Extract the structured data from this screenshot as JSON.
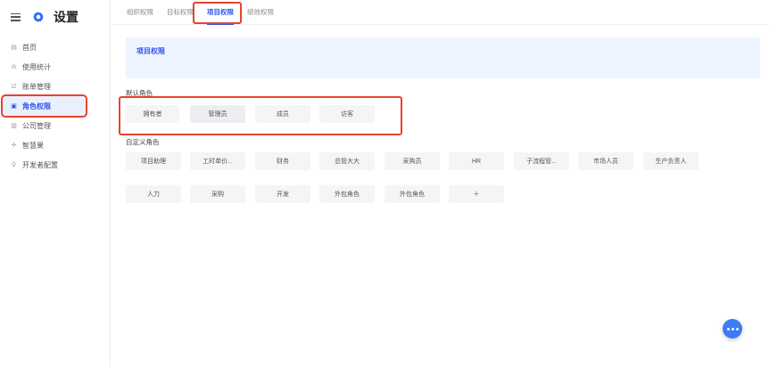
{
  "app": {
    "title": "设置"
  },
  "sidebar": {
    "items": [
      {
        "label": "首页",
        "icon": "home-icon"
      },
      {
        "label": "使用统计",
        "icon": "chart-icon"
      },
      {
        "label": "账单管理",
        "icon": "bill-icon"
      },
      {
        "label": "角色权限",
        "icon": "lock-icon",
        "active": true
      },
      {
        "label": "公司管理",
        "icon": "building-icon"
      },
      {
        "label": "智慧果",
        "icon": "fruit-icon"
      },
      {
        "label": "开发者配置",
        "icon": "key-icon"
      }
    ]
  },
  "tabs": [
    {
      "label": "组织权限"
    },
    {
      "label": "目标权限"
    },
    {
      "label": "项目权限",
      "active": true
    },
    {
      "label": "绩效权限"
    }
  ],
  "banner": {
    "title": "项目权限",
    "text": ""
  },
  "default_roles": {
    "label": "默认角色",
    "items": [
      "拥有者",
      "管理员",
      "成员",
      "访客"
    ],
    "active_index": 1
  },
  "custom_roles": {
    "label": "自定义角色",
    "row1": [
      "项目助理",
      "工时单价...",
      "财务",
      "总管大大",
      "采购员",
      "HR",
      "子流程管...",
      "市场人员",
      "生产负责人"
    ],
    "row2": [
      "人力",
      "采购",
      "开发",
      "外包角色",
      "外包角色",
      "+"
    ]
  },
  "colors": {
    "accent": "#2f54eb",
    "highlight": "#e5442f",
    "fab": "#3d7bf7"
  }
}
